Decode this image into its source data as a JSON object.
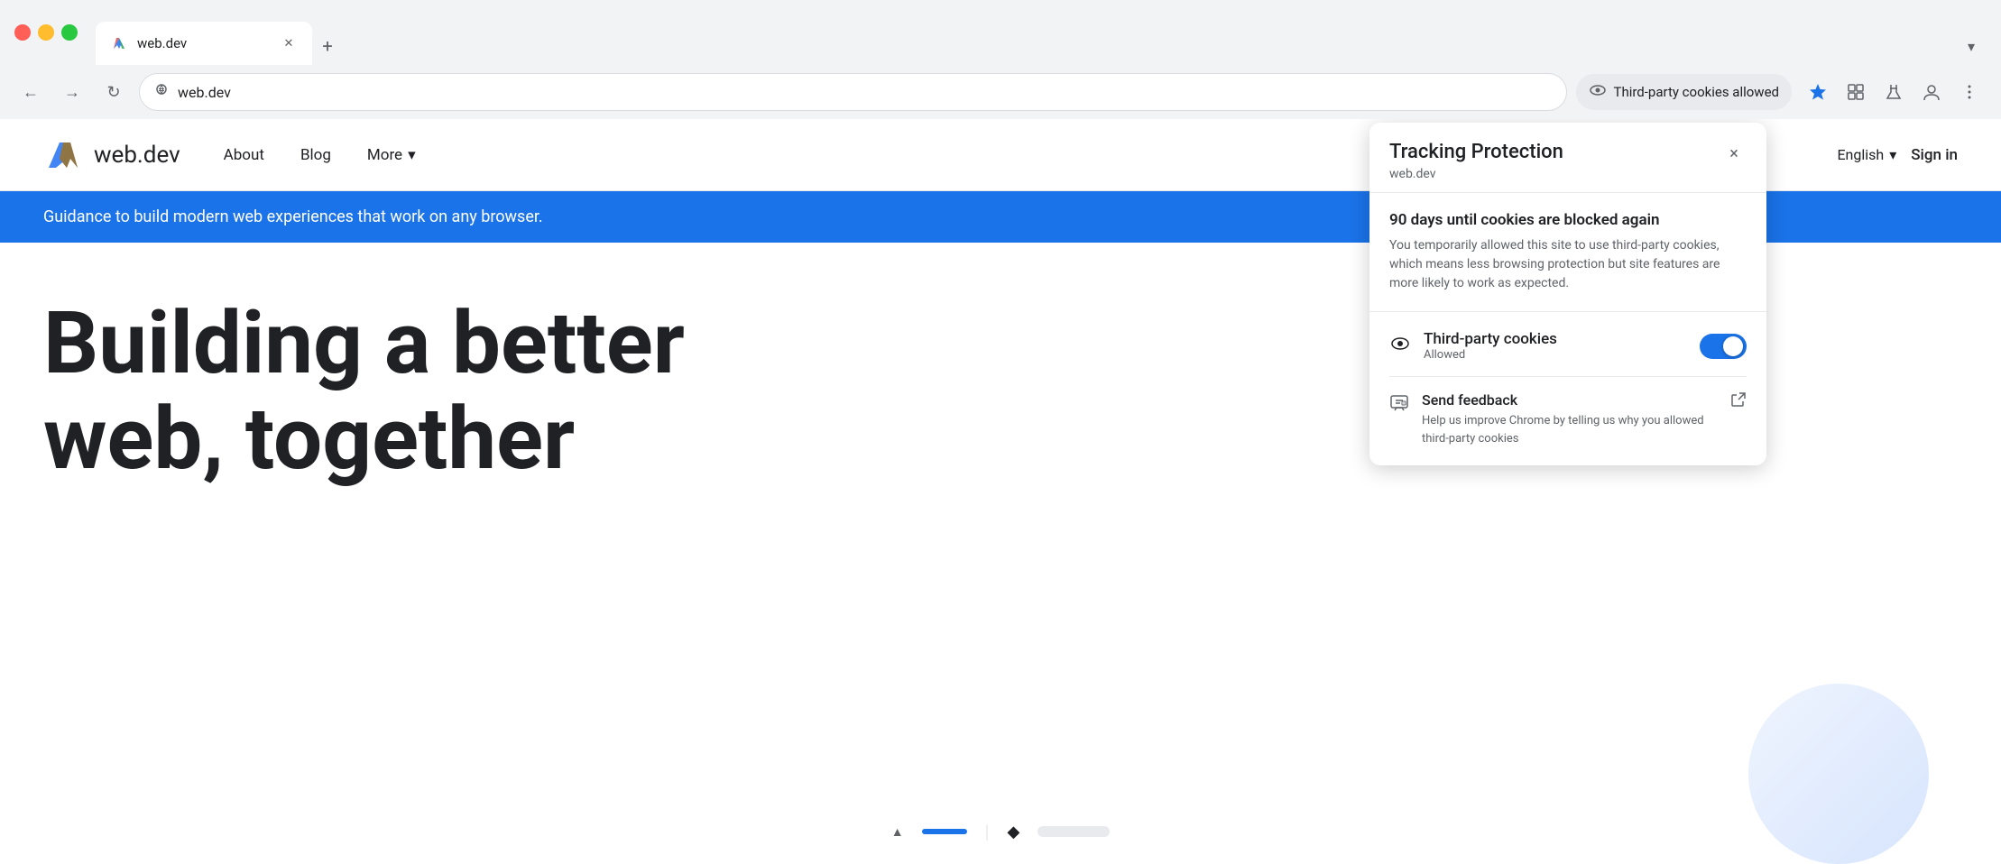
{
  "browser": {
    "tab_title": "web.dev",
    "address": "web.dev",
    "new_tab_icon": "+",
    "expand_icon": "▾"
  },
  "toolbar": {
    "back_icon": "←",
    "forward_icon": "→",
    "reload_icon": "↻",
    "tracking_label": "Third-party cookies allowed",
    "star_label": "Bookmark",
    "extensions_label": "Extensions",
    "labs_label": "Chrome Labs",
    "profile_label": "Profile",
    "menu_label": "More"
  },
  "site": {
    "logo_text": "web.dev",
    "nav": {
      "about": "About",
      "blog": "Blog",
      "more": "More",
      "language": "English",
      "sign_in": "Sign in"
    },
    "banner": "Guidance to build modern web experiences that work on any browser.",
    "headline_line1": "Building a better",
    "headline_line2": "web, together"
  },
  "popup": {
    "title": "Tracking Protection",
    "subtitle": "web.dev",
    "close_icon": "×",
    "days_title": "90 days until cookies are blocked again",
    "days_desc": "You temporarily allowed this site to use third-party cookies, which means less browsing protection but site features are more likely to work as expected.",
    "cookie_label": "Third-party cookies",
    "cookie_status": "Allowed",
    "feedback_title": "Send feedback",
    "feedback_desc": "Help us improve Chrome by telling us why you allowed third-party cookies"
  }
}
